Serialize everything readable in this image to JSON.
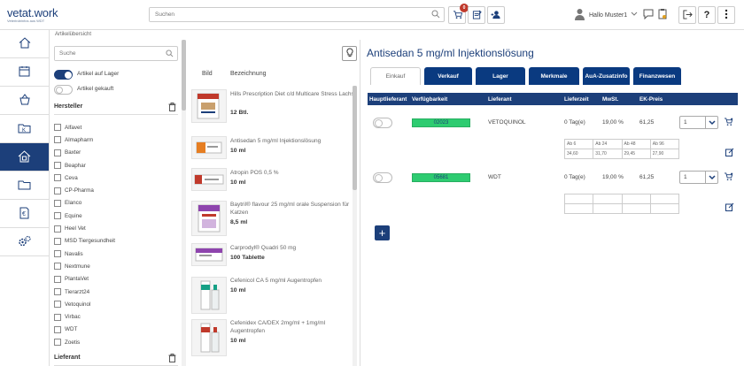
{
  "brand": {
    "name": "vetat.work",
    "tagline": "Veterinärinfos aus WDT"
  },
  "header": {
    "search_placeholder": "Suchen",
    "cart_count": "0",
    "user_greeting": "Hallo Muster1"
  },
  "breadcrumb": "Artikelübersicht",
  "sidebar": {
    "items": [
      {
        "icon": "home-icon"
      },
      {
        "icon": "calendar-icon"
      },
      {
        "icon": "cart-icon"
      },
      {
        "icon": "folder-k-icon"
      },
      {
        "icon": "home-doc-icon",
        "active": true
      },
      {
        "icon": "folder-icon"
      },
      {
        "icon": "euro-icon"
      },
      {
        "icon": "settings-icon"
      }
    ]
  },
  "filters": {
    "search_placeholder": "Suche",
    "toggle_stock": {
      "label": "Artikel auf Lager",
      "on": true
    },
    "toggle_bought": {
      "label": "Artikel gekauft",
      "on": false
    },
    "manufacturer_title": "Hersteller",
    "manufacturers": [
      "Alfavet",
      "Almapharm",
      "Baxter",
      "Beaphar",
      "Ceva",
      "CP-Pharma",
      "Elanco",
      "Equine",
      "Heel Vet",
      "MSD Tiergesundheit",
      "Navalis",
      "Nextmune",
      "PlantaVet",
      "Tierarzt24",
      "Vetoquinol",
      "Virbac",
      "WDT",
      "Zoetis"
    ],
    "supplier_title": "Lieferant"
  },
  "products": {
    "col_image": "Bild",
    "col_name": "Bezeichnung",
    "items": [
      {
        "name": "Hills Prescription Diet c/d Multicare Stress Lachs",
        "qty": "12 Btl."
      },
      {
        "name": "Antisedan 5 mg/ml Injektionslösung",
        "qty": "10 ml"
      },
      {
        "name": "Atropin POS 0,5 %",
        "qty": "10 ml"
      },
      {
        "name": "Baytril® flavour 25 mg/ml orale Suspension für Katzen",
        "qty": "8,5 ml"
      },
      {
        "name": "Carprodyl® Quadri 50 mg",
        "qty": "100 Tablette"
      },
      {
        "name": "Cefenicol CA 5 mg/ml Augentropfen",
        "qty": "10 ml"
      },
      {
        "name": "Cefenidex CA/DEX 2mg/ml + 1mg/ml Augentropfen",
        "qty": "10 ml"
      }
    ]
  },
  "detail": {
    "title": "Antisedan 5 mg/ml Injektionslösung",
    "tabs": [
      "Einkauf",
      "Verkauf",
      "Lager",
      "Merkmale",
      "AuA-Zusatzinfo",
      "Finanzwesen"
    ],
    "active_tab": "Einkauf",
    "columns": {
      "main_supplier": "Hauptlieferant",
      "availability": "Verfügbarkeit",
      "supplier": "Lieferant",
      "lead_time": "Lieferzeit",
      "vat": "MwSt.",
      "price": "EK-Preis"
    },
    "rows": [
      {
        "availability": "02023",
        "supplier": "VETOQUINOL",
        "lead_time": "0 Tag(e)",
        "vat": "19,00 %",
        "price": "61,25",
        "qty": "1",
        "tiers": [
          [
            "Ab 6",
            "Ab 24",
            "Ab 48",
            "Ab 96"
          ],
          [
            "34,60",
            "31,70",
            "29,45",
            "27,90"
          ]
        ]
      },
      {
        "availability": "05681",
        "supplier": "WDT",
        "lead_time": "0 Tag(e)",
        "vat": "19,00 %",
        "price": "61,25",
        "qty": "1",
        "tiers": [
          [
            "",
            "",
            "",
            ""
          ],
          [
            "",
            "",
            "",
            ""
          ]
        ]
      }
    ],
    "add_label": "+"
  },
  "colors": {
    "primary": "#1c3f7a",
    "tab": "#0a3a80",
    "available": "#2ecc71"
  }
}
